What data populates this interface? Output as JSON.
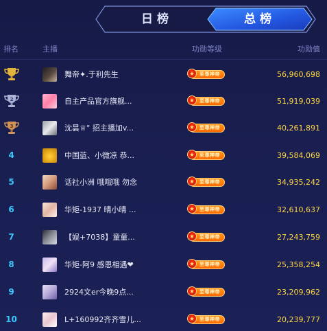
{
  "tabs": {
    "daily": "日榜",
    "total": "总榜",
    "active": "total"
  },
  "header": {
    "rank": "排名",
    "host": "主播",
    "level": "功勋等级",
    "value": "功勋值"
  },
  "rows": [
    {
      "rank": "1",
      "name": "舞帝✦.于利先生",
      "badge": "至尊神帝",
      "value": "56,960,698"
    },
    {
      "rank": "2",
      "name": "自主产品官方旗舰...",
      "badge": "至尊神帝",
      "value": "51,919,039"
    },
    {
      "rank": "3",
      "name": "沈昙♕° 招主播加v...",
      "badge": "至尊神帝",
      "value": "40,261,891"
    },
    {
      "rank": "4",
      "name": "中国蓝、小微凉 恭...",
      "badge": "至尊神帝",
      "value": "39,584,069"
    },
    {
      "rank": "5",
      "name": "话社小洲 哦哦哦 勿念",
      "badge": "至尊神帝",
      "value": "34,935,242"
    },
    {
      "rank": "6",
      "name": "华矩-1937 晴小晴 ...",
      "badge": "至尊神帝",
      "value": "32,610,637"
    },
    {
      "rank": "7",
      "name": "【娱+7038】童童...",
      "badge": "至尊神帝",
      "value": "27,243,759"
    },
    {
      "rank": "8",
      "name": "华矩-阿9 感恩相遇❤",
      "badge": "至尊神帝",
      "value": "25,358,254"
    },
    {
      "rank": "9",
      "name": "2924文er今晚9点...",
      "badge": "至尊神帝",
      "value": "23,209,962"
    },
    {
      "rank": "10",
      "name": "L+160992齐齐雪儿...",
      "badge": "至尊神帝",
      "value": "20,239,777"
    }
  ],
  "colors": {
    "gold": "#e2b53a",
    "silver": "#a9b3d6",
    "bronze": "#cf9258",
    "value": "#ffd740",
    "rank": "#3ec7ff"
  }
}
